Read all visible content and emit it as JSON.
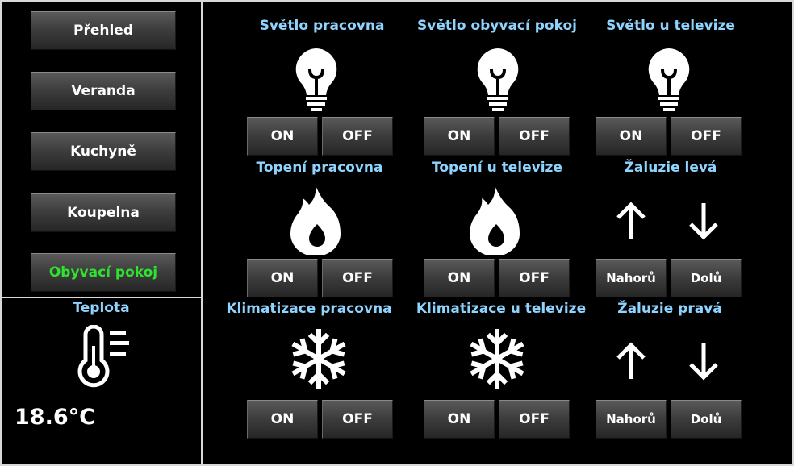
{
  "nav": [
    {
      "label": "Přehled"
    },
    {
      "label": "Veranda"
    },
    {
      "label": "Kuchyně"
    },
    {
      "label": "Koupelna"
    },
    {
      "label": "Obyvací pokoj",
      "active": true
    }
  ],
  "temperature": {
    "title": "Teplota",
    "value": "18.6°C",
    "icon": "thermometer-icon"
  },
  "devices": [
    {
      "name": "Světlo pracovna",
      "icon": "lightbulb-icon",
      "buttons": [
        "ON",
        "OFF"
      ]
    },
    {
      "name": "Světlo obyvací pokoj",
      "icon": "lightbulb-icon",
      "buttons": [
        "ON",
        "OFF"
      ]
    },
    {
      "name": "Světlo u televize",
      "icon": "lightbulb-icon",
      "buttons": [
        "ON",
        "OFF"
      ]
    },
    {
      "name": "Topení pracovna",
      "icon": "flame-icon",
      "buttons": [
        "ON",
        "OFF"
      ]
    },
    {
      "name": "Topení u televize",
      "icon": "flame-icon",
      "buttons": [
        "ON",
        "OFF"
      ]
    },
    {
      "name": "Žaluzie levá",
      "icon": "arrows-icon",
      "buttons": [
        "Nahorů",
        "Dolů"
      ]
    },
    {
      "name": "Klimatizace pracovna",
      "icon": "snowflake-icon",
      "buttons": [
        "ON",
        "OFF"
      ]
    },
    {
      "name": "Klimatizace u televize",
      "icon": "snowflake-icon",
      "buttons": [
        "ON",
        "OFF"
      ]
    },
    {
      "name": "Žaluzie pravá",
      "icon": "arrows-icon",
      "buttons": [
        "Nahorů",
        "Dolů"
      ]
    }
  ],
  "colors": {
    "label": "#8fd3ff",
    "active_nav": "#2fe22f",
    "background": "#000000"
  }
}
